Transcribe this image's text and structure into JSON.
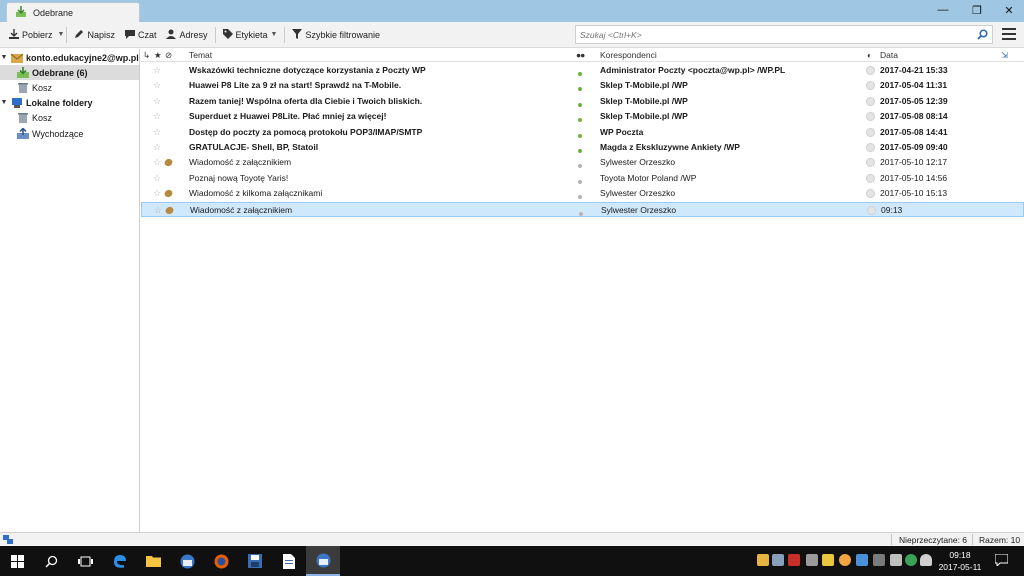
{
  "window": {
    "tab_title": "Odebrane",
    "controls": {
      "minimize": "—",
      "maximize": "❐",
      "close": "✕"
    }
  },
  "toolbar": {
    "get_mail": "Pobierz",
    "write": "Napisz",
    "chat": "Czat",
    "address_book": "Adresy",
    "tag": "Etykieta",
    "quick_filter": "Szybkie filtrowanie"
  },
  "search": {
    "placeholder": "Szukaj <Ctrl+K>"
  },
  "folders": [
    {
      "label": "konto.edukacyjne2@wp.pl",
      "level": 0,
      "bold": true,
      "icon": "account-icon"
    },
    {
      "label": "Odebrane (6)",
      "level": 1,
      "bold": true,
      "selected": true,
      "icon": "inbox-icon"
    },
    {
      "label": "Kosz",
      "level": 1,
      "icon": "trash-icon"
    },
    {
      "label": "Lokalne foldery",
      "level": 0,
      "bold": true,
      "icon": "local-folders-icon"
    },
    {
      "label": "Kosz",
      "level": 1,
      "icon": "trash-icon"
    },
    {
      "label": "Wychodzące",
      "level": 1,
      "icon": "outbox-icon"
    }
  ],
  "columns": {
    "subject": "Temat",
    "correspondents": "Korespondenci",
    "date": "Data"
  },
  "messages": [
    {
      "subject": "Wskazówki techniczne dotyczące korzystania z Poczty WP",
      "from": "Administrator Poczty <poczta@wp.pl> /WP.PL",
      "date": "2017-04-21 15:33",
      "unread": true,
      "attachment": false
    },
    {
      "subject": "Huawei P8 Lite za 9 zł na start! Sprawdź na T-Mobile.",
      "from": "Sklep T-Mobile.pl /WP",
      "date": "2017-05-04 11:31",
      "unread": true,
      "attachment": false
    },
    {
      "subject": "Razem taniej! Wspólna oferta dla Ciebie i Twoich bliskich.",
      "from": "Sklep T-Mobile.pl /WP",
      "date": "2017-05-05 12:39",
      "unread": true,
      "attachment": false
    },
    {
      "subject": "Superduet z Huawei P8Lite. Płać mniej za więcej!",
      "from": "Sklep T-Mobile.pl /WP",
      "date": "2017-05-08 08:14",
      "unread": true,
      "attachment": false
    },
    {
      "subject": "Dostęp do poczty za pomocą protokołu POP3/IMAP/SMTP",
      "from": "WP Poczta",
      "date": "2017-05-08 14:41",
      "unread": true,
      "attachment": false
    },
    {
      "subject": "GRATULACJE- Shell, BP, Statoil",
      "from": "Magda z Ekskluzywne Ankiety /WP",
      "date": "2017-05-09 09:40",
      "unread": true,
      "attachment": false
    },
    {
      "subject": "Wiadomość z załącznikiem",
      "from": "Sylwester Orzeszko",
      "date": "2017-05-10 12:17",
      "unread": false,
      "attachment": true
    },
    {
      "subject": "Poznaj nową Toyotę Yaris!",
      "from": "Toyota Motor Poland /WP",
      "date": "2017-05-10 14:56",
      "unread": false,
      "attachment": false
    },
    {
      "subject": "Wiadomość z kilkoma załącznikami",
      "from": "Sylwester Orzeszko",
      "date": "2017-05-10 15:13",
      "unread": false,
      "attachment": true
    },
    {
      "subject": "Wiadomość z załącznikiem",
      "from": "Sylwester Orzeszko",
      "date": "09:13",
      "unread": false,
      "attachment": true,
      "selected": true
    }
  ],
  "status": {
    "unread": "Nieprzeczytane: 6",
    "total": "Razem: 10"
  },
  "clock": {
    "time": "09:18",
    "date": "2017-05-11"
  },
  "colors": {
    "titlebar": "#9fc6e3",
    "selection": "#cfe8fc",
    "unread_dot": "#6cb33f",
    "read_dot": "#b5b5b5"
  }
}
